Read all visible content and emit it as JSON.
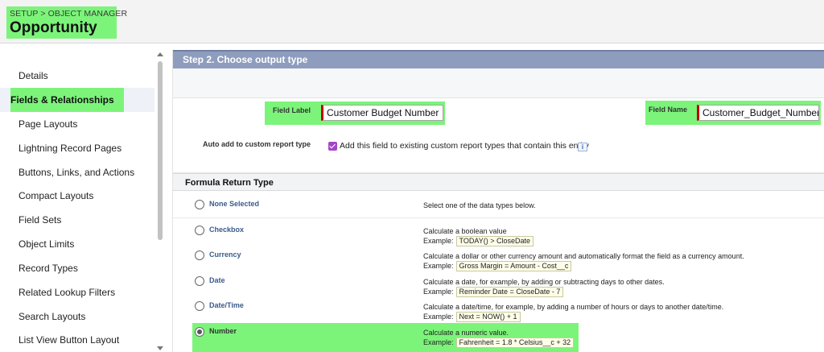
{
  "header": {
    "breadcrumb": "SETUP > OBJECT MANAGER",
    "title": "Opportunity"
  },
  "sidebar": {
    "items": [
      {
        "label": "Details"
      },
      {
        "label": "Fields & Relationships",
        "active": true
      },
      {
        "label": "Page Layouts"
      },
      {
        "label": "Lightning Record Pages"
      },
      {
        "label": "Buttons, Links, and Actions"
      },
      {
        "label": "Compact Layouts"
      },
      {
        "label": "Field Sets"
      },
      {
        "label": "Object Limits"
      },
      {
        "label": "Record Types"
      },
      {
        "label": "Related Lookup Filters"
      },
      {
        "label": "Search Layouts"
      },
      {
        "label": "List View Button Layout"
      }
    ]
  },
  "main": {
    "step_title": "Step 2. Choose output type",
    "field_label": {
      "label": "Field Label",
      "value": "Customer Budget Number"
    },
    "field_name": {
      "label": "Field Name",
      "value": "Customer_Budget_Number"
    },
    "auto_add": {
      "label": "Auto add to custom report type",
      "text": "Add this field to existing custom report types that contain this entity",
      "checked": true,
      "info_icon": "i"
    },
    "formula_return_type": {
      "heading": "Formula Return Type",
      "options": [
        {
          "name": "None Selected",
          "desc": "Select one of the data types below.",
          "example": "",
          "selected": false
        },
        {
          "name": "Checkbox",
          "desc": "Calculate a boolean value",
          "example_label": "Example:",
          "example": "TODAY() > CloseDate",
          "selected": false
        },
        {
          "name": "Currency",
          "desc": "Calculate a dollar or other currency amount and automatically format the field as a currency amount.",
          "example_label": "Example:",
          "example": "Gross Margin = Amount - Cost__c",
          "selected": false
        },
        {
          "name": "Date",
          "desc": "Calculate a date, for example, by adding or subtracting days to other dates.",
          "example_label": "Example:",
          "example": "Reminder Date = CloseDate - 7",
          "selected": false
        },
        {
          "name": "Date/Time",
          "desc": "Calculate a date/time, for example, by adding a number of hours or days to another date/time.",
          "example_label": "Example:",
          "example": "Next = NOW() + 1",
          "selected": false
        },
        {
          "name": "Number",
          "desc": "Calculate a numeric value.",
          "example_label": "Example:",
          "example": "Fahrenheit = 1.8 * Celsius__c + 32",
          "selected": true
        }
      ]
    }
  },
  "colors": {
    "highlight": "#7cf47a",
    "step_bar": "#8e9dbe",
    "option_name": "#3a5a8c",
    "required_marker": "#c00000",
    "checkbox": "#a445c9"
  }
}
